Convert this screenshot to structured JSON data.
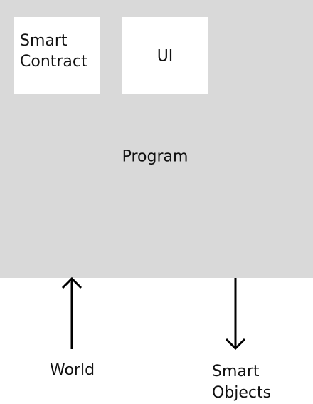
{
  "program": {
    "label": "Program",
    "modules": {
      "contract": "Smart\nContract",
      "ui": "UI"
    }
  },
  "io": {
    "input_label": "World",
    "output_label": "Smart\nObjects"
  },
  "colors": {
    "program_fill": "#d9d9d9",
    "module_fill": "#ffffff",
    "stroke": "#000000"
  },
  "icons": {
    "input_arrow": "arrow-up-icon",
    "output_arrow": "arrow-down-icon"
  }
}
